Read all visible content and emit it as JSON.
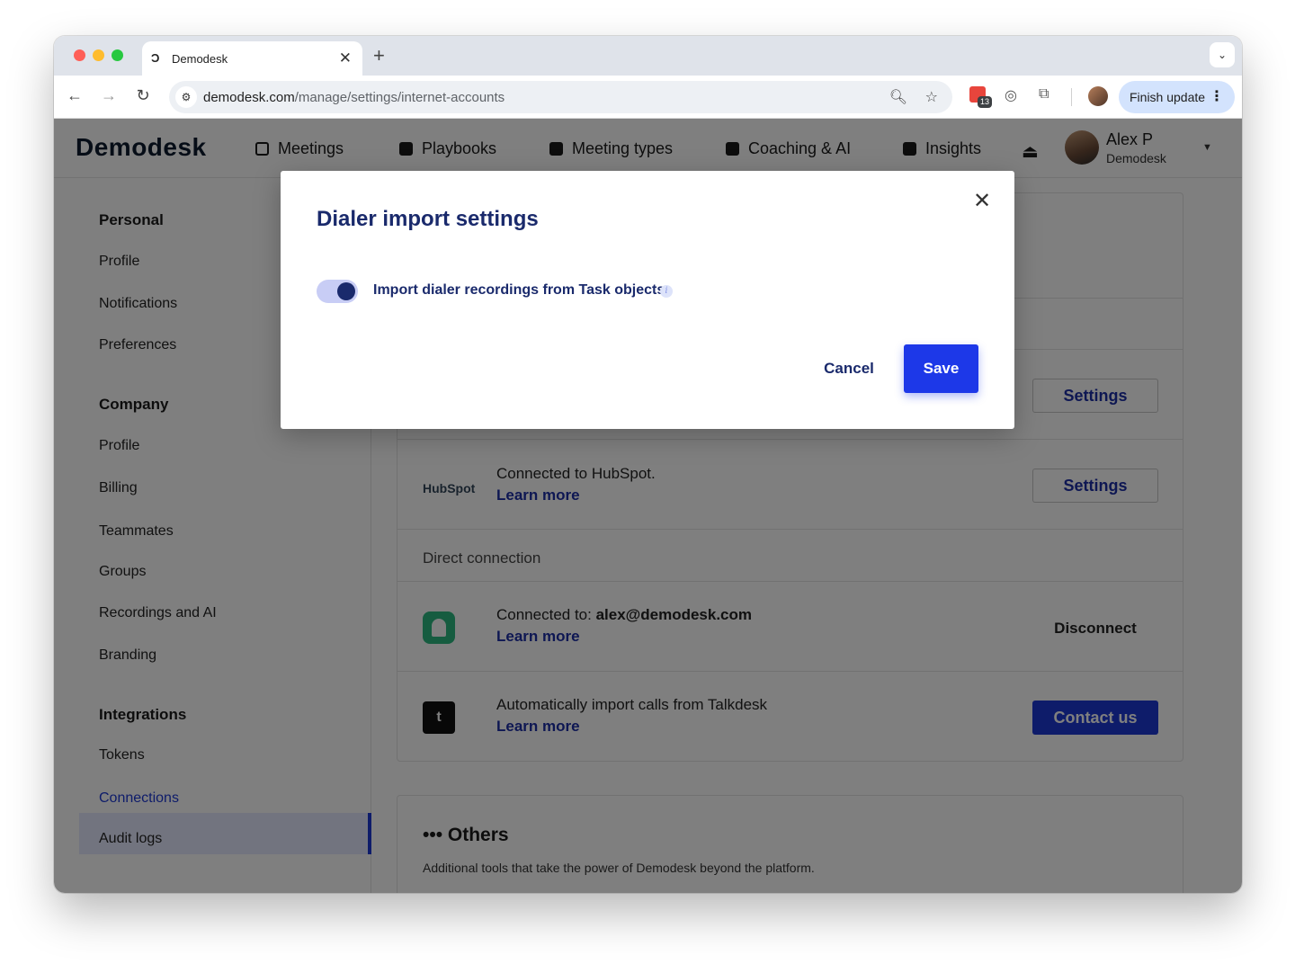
{
  "browser": {
    "tab_title": "Demodesk",
    "tab_favicon": "Ɔ",
    "new_tab": "+",
    "url_host": "demodesk.com",
    "url_path": "/manage/settings/internet-accounts",
    "extension_badge": "13",
    "finish_update_label": "Finish update"
  },
  "app": {
    "logo": "Demodesk",
    "nav": [
      {
        "label": "Meetings",
        "icon": "calendar-icon"
      },
      {
        "label": "Playbooks",
        "icon": "play-icon"
      },
      {
        "label": "Meeting types",
        "icon": "grid-icon"
      },
      {
        "label": "Coaching & AI",
        "icon": "graduation-cap-icon"
      },
      {
        "label": "Insights",
        "icon": "bar-chart-icon"
      }
    ],
    "user": {
      "name": "Alex P",
      "org": "Demodesk"
    }
  },
  "sidebar": {
    "personal": {
      "heading": "Personal",
      "items": [
        "Profile",
        "Notifications",
        "Preferences"
      ]
    },
    "company": {
      "heading": "Company",
      "items": [
        "Profile",
        "Billing",
        "Teammates",
        "Groups",
        "Recordings and AI",
        "Branding"
      ]
    },
    "integrations": {
      "heading": "Integrations",
      "items": [
        "Tokens",
        "Connections",
        "Audit logs"
      ],
      "active": "Connections"
    }
  },
  "connections": {
    "settings_label": "Settings",
    "hubspot": {
      "logo_text": "HubSpot",
      "text": "Connected to HubSpot.",
      "link": "Learn more"
    },
    "direct_connection_label": "Direct connection",
    "aircall": {
      "prefix": "Connected to: ",
      "email": "alex@demodesk.com",
      "link": "Learn more",
      "action": "Disconnect"
    },
    "talkdesk": {
      "logo_text": "t",
      "text": "Automatically import calls from Talkdesk",
      "link": "Learn more",
      "action": "Contact us"
    }
  },
  "others": {
    "title": "Others",
    "description": "Additional tools that take the power of Demodesk beyond the platform."
  },
  "modal": {
    "title": "Dialer import settings",
    "toggle_label": "Import dialer recordings from Task objects",
    "toggle_on": true,
    "info_glyph": "i",
    "cancel_label": "Cancel",
    "save_label": "Save"
  }
}
